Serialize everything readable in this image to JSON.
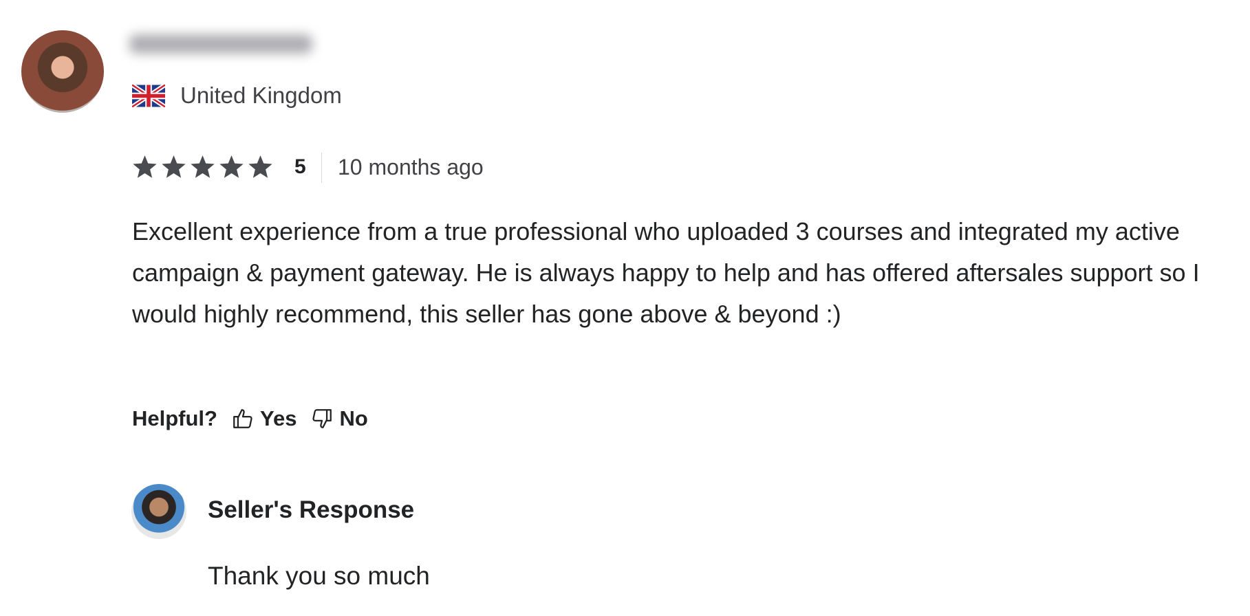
{
  "review": {
    "country": "United Kingdom",
    "rating": "5",
    "star_count": 5,
    "time_ago": "10 months ago",
    "text": "Excellent experience from a true professional who uploaded 3 courses and integrated my active campaign & payment gateway. He is always happy to help and has offered aftersales support so I would highly recommend, this seller has gone above & beyond :)",
    "helpful_label": "Helpful?",
    "yes_label": "Yes",
    "no_label": "No"
  },
  "seller_response": {
    "title": "Seller's Response",
    "text": "Thank you so much"
  },
  "colors": {
    "star": "#4a4b50",
    "text": "#222325",
    "muted": "#404145"
  }
}
